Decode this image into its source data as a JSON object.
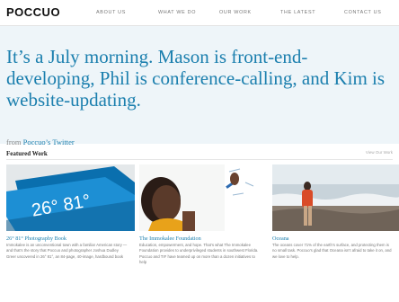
{
  "header": {
    "logo": "POCCUO",
    "nav": [
      "ABOUT US",
      "WHAT WE DO",
      "OUR WORK",
      "THE LATEST",
      "CONTACT US"
    ]
  },
  "hero": {
    "text": "It’s a July morning. Mason is front-end-developing, Phil is conference-calling, and Kim is website-updating.",
    "from_prefix": "from",
    "from_link": "Poccuo’s Twitter"
  },
  "featured": {
    "heading": "Featured Work",
    "view_all": "View Our Work",
    "cards": [
      {
        "image_text": "26° 81°",
        "title": "26° 81° Photography Book",
        "desc": "Immokalee is an unconventional town with a familiar American story — and that’s the story that Poccuo and photographer Joshua Dudley Greer uncovered in 26° 81°, an 84-page, 40-image, hardbound book"
      },
      {
        "title": "The Immokalee Foundation",
        "desc": "Education, empowerment, and hope. That’s what The Immokalee Foundation provides to underprivileged students in southwest Florida. Poccuo and TIF have teamed up on more than a dozen initiatives to help"
      },
      {
        "title": "Oceana",
        "desc": "The oceans cover 71% of the earth’s surface, and protecting them is no small task. Poccuo’s glad that Oceana isn’t afraid to take it on, and we love to help."
      }
    ]
  },
  "colors": {
    "accent": "#1b7fae",
    "hero_bg": "#eef5f9"
  }
}
